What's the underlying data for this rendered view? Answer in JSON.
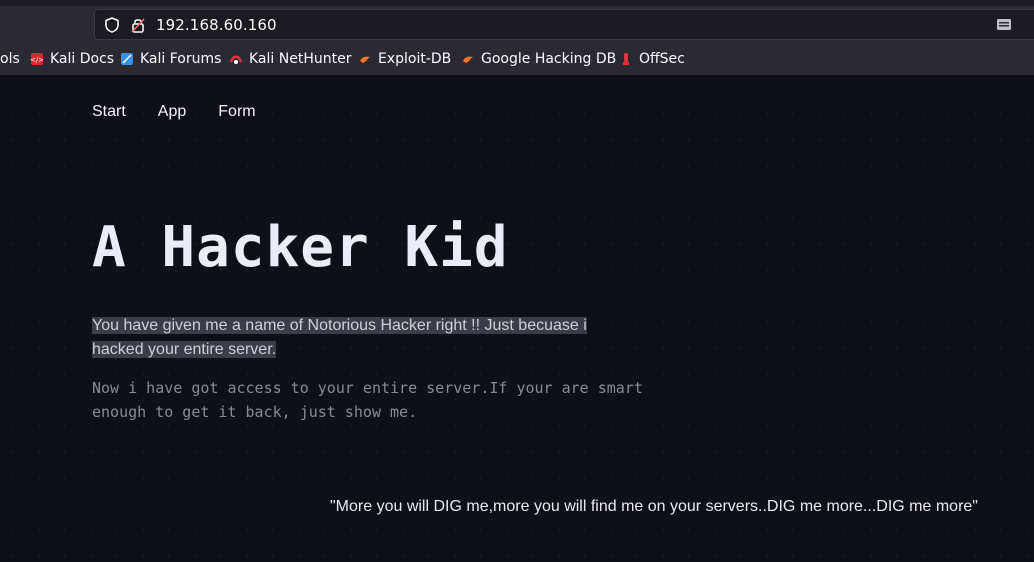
{
  "browser": {
    "url": "192.168.60.160",
    "bookmarks": [
      {
        "label": "ols",
        "icon": "partial-bookmark"
      },
      {
        "label": "Kali Docs",
        "icon": "kali-docs-icon"
      },
      {
        "label": "Kali Forums",
        "icon": "kali-forums-icon"
      },
      {
        "label": "Kali NetHunter",
        "icon": "kali-nethunter-icon"
      },
      {
        "label": "Exploit-DB",
        "icon": "exploit-db-icon"
      },
      {
        "label": "Google Hacking DB",
        "icon": "google-hacking-db-icon"
      },
      {
        "label": "OffSec",
        "icon": "offsec-icon"
      }
    ]
  },
  "nav": {
    "items": [
      "Start",
      "App",
      "Form"
    ]
  },
  "hero": {
    "title": "A Hacker Kid",
    "lead": "You have given me a name of Notorious Hacker right !! Just becuase i hacked your entire server.",
    "paragraph": "Now i have got access to your entire server.If your are smart enough to get it back, just show me.",
    "quote": "\"More you will DIG me,more you will find me on your servers..DIG me more...DIG me more\""
  },
  "colors": {
    "page_bg": "#0f0f17",
    "chrome_bg": "#2b2a33",
    "highlight": "#3d3d47"
  }
}
